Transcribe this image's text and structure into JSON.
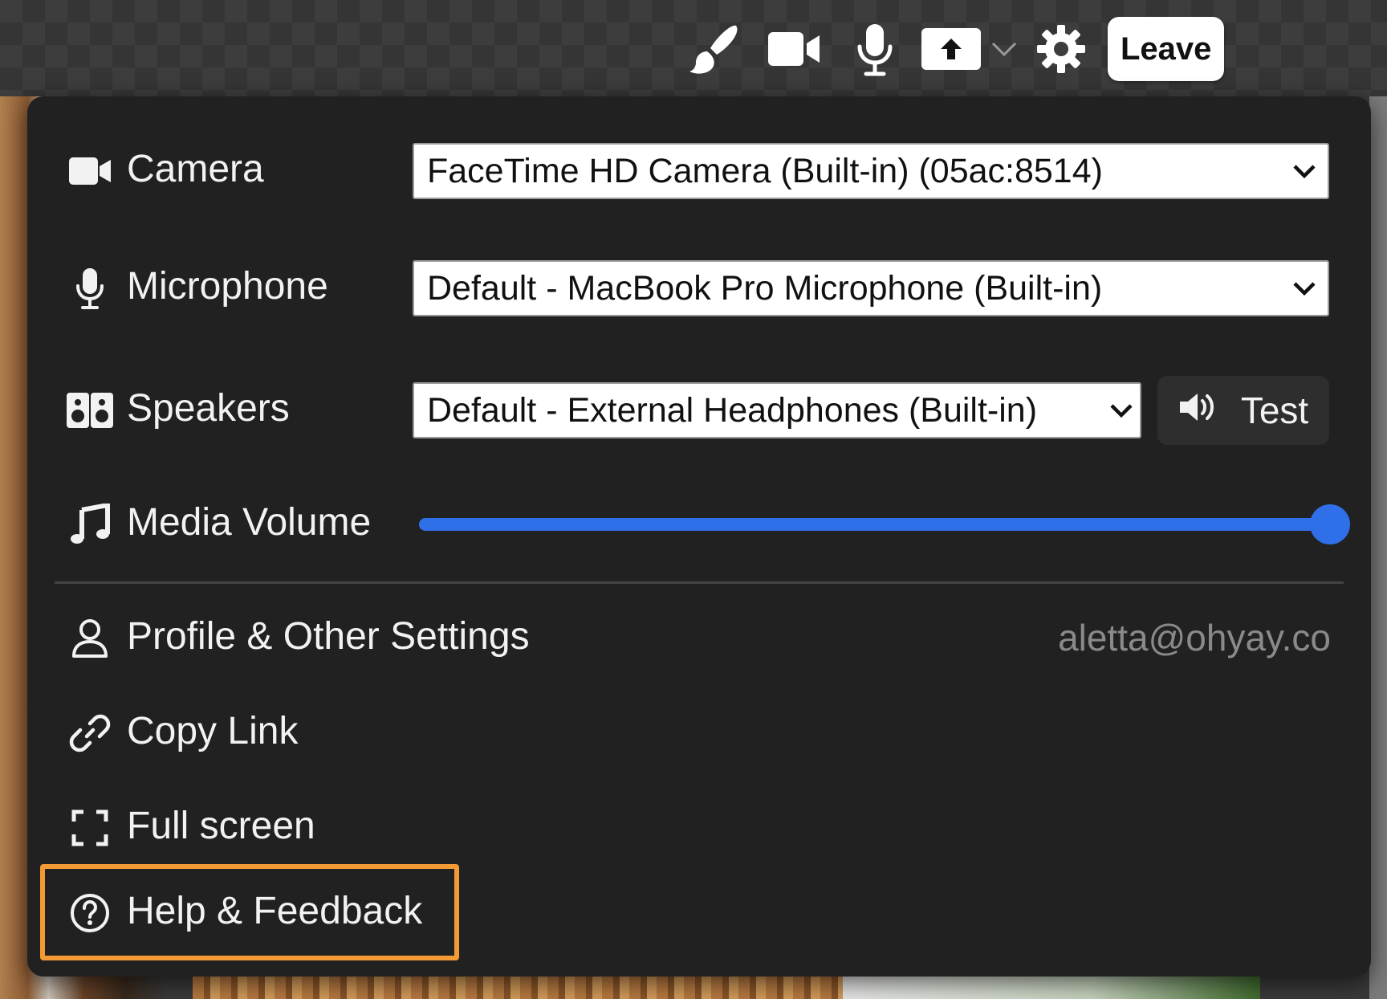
{
  "toolbar": {
    "icons": [
      "paintbrush-icon",
      "video-camera-icon",
      "microphone-icon",
      "share-upload-icon",
      "chevron-down-icon",
      "gear-icon"
    ],
    "leave_label": "Leave"
  },
  "settings": {
    "camera": {
      "label": "Camera",
      "icon": "video-camera-icon",
      "selected": "FaceTime HD Camera (Built-in) (05ac:8514)"
    },
    "microphone": {
      "label": "Microphone",
      "icon": "microphone-icon",
      "selected": "Default - MacBook Pro Microphone (Built-in)"
    },
    "speakers": {
      "label": "Speakers",
      "icon": "speakers-icon",
      "selected": "Default - External Headphones (Built-in)",
      "test_label": "Test"
    },
    "media_volume": {
      "label": "Media Volume",
      "icon": "music-note-icon",
      "level": 1.0
    }
  },
  "menu": {
    "profile": {
      "label": "Profile & Other Settings",
      "email": "aletta@ohyay.co",
      "icon": "user-icon"
    },
    "copy_link": {
      "label": "Copy Link",
      "icon": "link-icon"
    },
    "full_screen": {
      "label": "Full screen",
      "icon": "fullscreen-icon"
    },
    "help": {
      "label": "Help & Feedback",
      "icon": "help-circle-icon",
      "highlighted": true
    }
  },
  "colors": {
    "panel_bg": "#212121",
    "accent_blue": "#2f6fe8",
    "highlight_orange": "#f39a34",
    "muted_text": "#8a8a8a"
  }
}
